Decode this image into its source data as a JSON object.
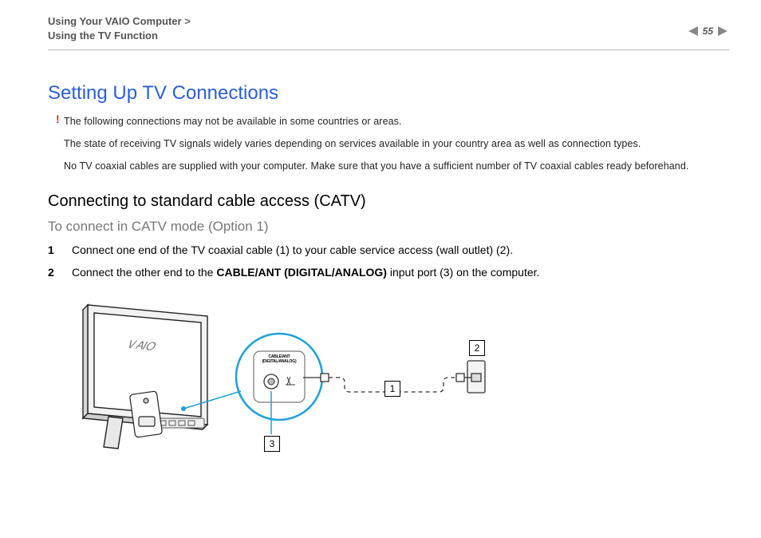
{
  "header": {
    "breadcrumb_line1": "Using Your VAIO Computer",
    "breadcrumb_sep": ">",
    "breadcrumb_line2": "Using the TV Function",
    "page_number": "55"
  },
  "title": "Setting Up TV Connections",
  "warning_mark": "!",
  "notes": {
    "n1": "The following connections may not be available in some countries or areas.",
    "n2": "The state of receiving TV signals widely varies depending on services available in your country area as well as connection types.",
    "n3": "No TV coaxial cables are supplied with your computer. Make sure that you have a sufficient number of TV coaxial cables ready beforehand."
  },
  "section_heading": "Connecting to standard cable access (CATV)",
  "sub_heading": "To connect in CATV mode (Option 1)",
  "steps": {
    "s1": "Connect one end of the TV coaxial cable (1) to your cable service access (wall outlet) (2).",
    "s2_pre": "Connect the other end to the ",
    "s2_bold": "CABLE/ANT (DIGITAL/ANALOG)",
    "s2_post": " input port (3) on the computer."
  },
  "diagram": {
    "callout1": "1",
    "callout2": "2",
    "callout3": "3",
    "port_label_top": "CABLE/ANT",
    "port_label_bottom": "(DIGITAL/ANALOG)",
    "logo": "VAIO"
  }
}
